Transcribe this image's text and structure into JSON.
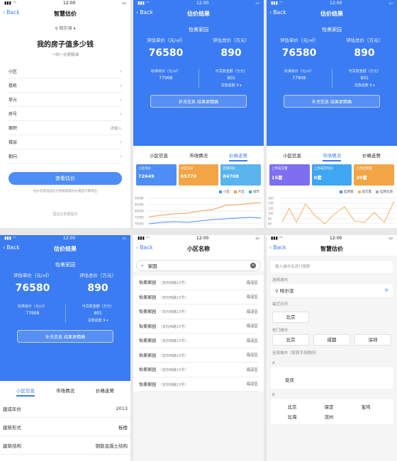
{
  "status": {
    "time": "12:00"
  },
  "back": "Back",
  "screen1": {
    "title": "智慧估价",
    "city": "哈尔滨",
    "heading": "我的房子值多少钱",
    "subheading": "一网一价更精准",
    "fields": [
      {
        "label": "小区",
        "value": ""
      },
      {
        "label": "楼栋",
        "value": ""
      },
      {
        "label": "单元",
        "value": ""
      },
      {
        "label": "房号",
        "value": ""
      },
      {
        "label": "面积",
        "value": "请输入"
      },
      {
        "label": "楼层",
        "value": ""
      },
      {
        "label": "朝向",
        "value": ""
      }
    ],
    "button": "查看估价",
    "note": "估价结果由国信达数据根据估价模型计算得出",
    "footer": "国信达数据提供"
  },
  "result": {
    "title": "估价结果",
    "community": "怡美家园",
    "unit_price_label": "评估单价（元/㎡）",
    "unit_price": "76580",
    "total_label": "评估总价（万元）",
    "total": "890",
    "standard_label": "标准房价（元/㎡）",
    "standard": "77908",
    "loan_label": "可贷款金额（万元）",
    "loan": "801",
    "ratio": "贷款成数 9",
    "button": "补充信息 结果更精确",
    "tabs": [
      "小区信息",
      "市场情况",
      "价格走势"
    ]
  },
  "screen2": {
    "cards": [
      {
        "title": "小区均价",
        "value": "72649",
        "color": "#4d8df5"
      },
      {
        "title": "片区均价",
        "value": "85770",
        "color": "#f2a545"
      },
      {
        "title": "区域均价",
        "value": "84708",
        "color": "#5ab4ee"
      }
    ],
    "legend": [
      "小区",
      "片区",
      "城市"
    ],
    "yticks": [
      "90000",
      "85000",
      "80000",
      "75000",
      "70000"
    ]
  },
  "screen3": {
    "cards": [
      {
        "title": "上月成交量",
        "value": "15套",
        "color": "#7d6ff0"
      },
      {
        "title": "上月成交均价",
        "value": "0套",
        "color": "#3fa6f2"
      },
      {
        "title": "上月挂牌量",
        "value": "39套",
        "color": "#f2a545"
      }
    ],
    "legend": [
      "挂牌量",
      "成交量",
      "挂牌房源"
    ],
    "yticks": [
      "160",
      "140",
      "120",
      "100",
      "80",
      "60"
    ]
  },
  "screen4": {
    "info": [
      {
        "label": "建成年份",
        "value": "2013"
      },
      {
        "label": "建筑形式",
        "value": "板楼"
      },
      {
        "label": "建筑结构",
        "value": "钢筋混凝土结构"
      }
    ]
  },
  "screen5": {
    "title": "小区名称",
    "query": "家园",
    "results": [
      {
        "name": "怡美家园",
        "addr": "（安庆西路15号）",
        "district": "海淀区"
      },
      {
        "name": "怡美家园",
        "addr": "（安庆西路15号）",
        "district": "海淀区"
      },
      {
        "name": "怡美家园",
        "addr": "（安庆西路15号）",
        "district": "海淀区"
      },
      {
        "name": "怡美家园",
        "addr": "（安庆西路15号）",
        "district": "海淀区"
      },
      {
        "name": "怡美家园",
        "addr": "（安庆西路15号）",
        "district": "海淀区"
      },
      {
        "name": "怡美家园",
        "addr": "（安庆西路15号）",
        "district": "海淀区"
      },
      {
        "name": "怡美家园",
        "addr": "（安庆西路15号）",
        "district": "海淀区"
      },
      {
        "name": "怡美家园",
        "addr": "（安庆西路15号）",
        "district": "海淀区"
      }
    ]
  },
  "screen6": {
    "title": "智慧估价",
    "placeholder": "输入城市名进行搜索",
    "select_label": "选择城市",
    "current_city": "哈尔滨",
    "recent_label": "最近访问",
    "recent": [
      "北京"
    ],
    "hot_label": "热门城市",
    "hot": [
      "北京",
      "成都",
      "深圳"
    ],
    "all_label": "全部城市（按首字母顺序）",
    "letter_a": "A",
    "a_cities": [
      "安庆"
    ],
    "letter_b": "B",
    "b_cities": [
      "北京",
      "保定",
      "宝鸡",
      "北海",
      "滨州"
    ]
  }
}
